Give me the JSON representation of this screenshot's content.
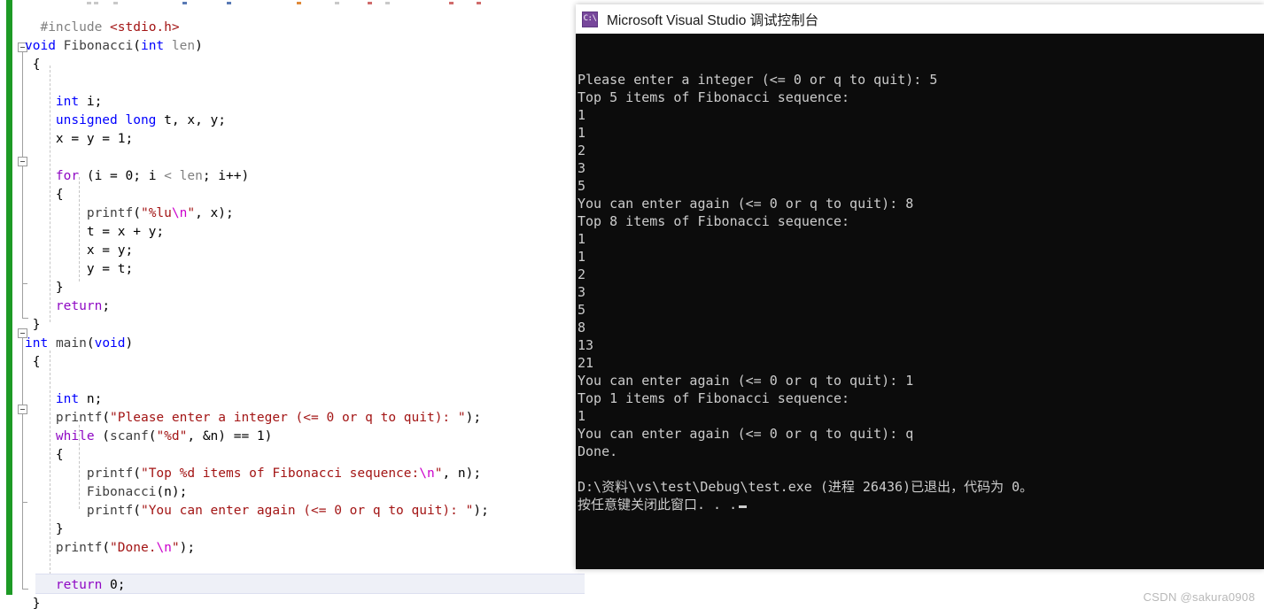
{
  "editor": {
    "name": "visual-studio-code-editor",
    "change_bar_color": "#1d9a25",
    "code_lines": [
      "",
      "  #include <stdio.h>",
      "void Fibonacci(int len)",
      " {",
      "",
      "     int i;",
      "     unsigned long t, x, y;",
      "     x = y = 1;",
      "",
      "     for (i = 0; i < len; i++)",
      "     {",
      "         printf(\"%lu\\n\", x);",
      "         t = x + y;",
      "         x = y;",
      "         y = t;",
      "     }",
      "     return;",
      " }",
      "int main(void)",
      " {",
      "",
      "     int n;",
      "     printf(\"Please enter a integer (<= 0 or q to quit): \");",
      "     while (scanf(\"%d\", &n) == 1)",
      "     {",
      "         printf(\"Top %d items of Fibonacci sequence:\\n\", n);",
      "         Fibonacci(n);",
      "         printf(\"You can enter again (<= 0 or q to quit): \");",
      "     }",
      "     printf(\"Done.\\n\");",
      "",
      "     return 0;",
      " }"
    ]
  },
  "console": {
    "title": "Microsoft Visual Studio 调试控制台",
    "icon": "console-cmd-icon",
    "icon_label": "C:\\",
    "background": "#0c0c0c",
    "foreground": "#cccccc",
    "lines": [
      "Please enter a integer (<= 0 or q to quit): 5",
      "Top 5 items of Fibonacci sequence:",
      "1",
      "1",
      "2",
      "3",
      "5",
      "You can enter again (<= 0 or q to quit): 8",
      "Top 8 items of Fibonacci sequence:",
      "1",
      "1",
      "2",
      "3",
      "5",
      "8",
      "13",
      "21",
      "You can enter again (<= 0 or q to quit): 1",
      "Top 1 items of Fibonacci sequence:",
      "1",
      "You can enter again (<= 0 or q to quit): q",
      "Done.",
      "",
      "D:\\资料\\vs\\test\\Debug\\test.exe (进程 26436)已退出，代码为 0。"
    ],
    "last_line": "按任意键关闭此窗口. . ."
  },
  "watermark": {
    "text": "CSDN @sakura0908"
  }
}
